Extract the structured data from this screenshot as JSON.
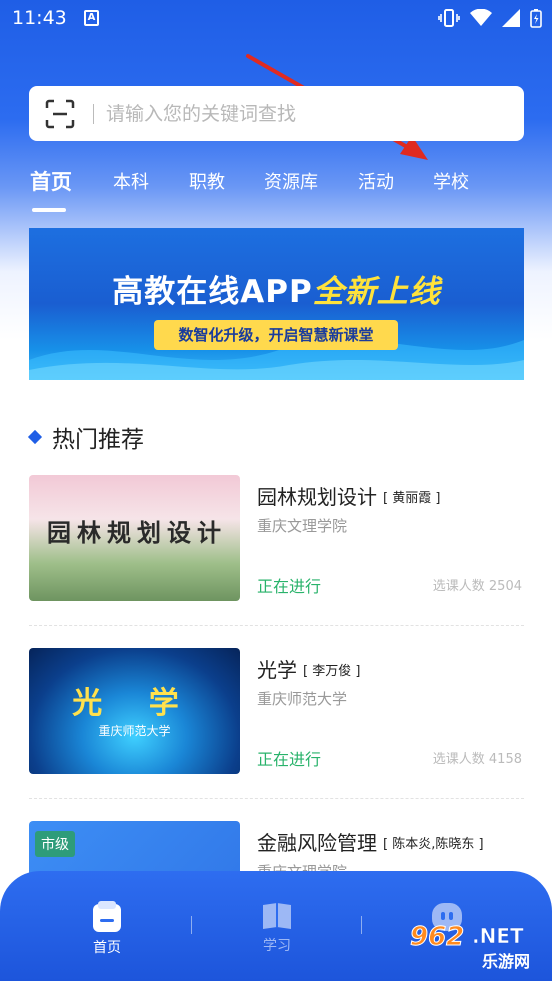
{
  "status_bar": {
    "time": "11:43",
    "app_icon": "A"
  },
  "search": {
    "placeholder": "请输入您的关键词查找",
    "value": ""
  },
  "tabs": [
    {
      "label": "首页",
      "active": true
    },
    {
      "label": "本科",
      "active": false
    },
    {
      "label": "职教",
      "active": false
    },
    {
      "label": "资源库",
      "active": false
    },
    {
      "label": "活动",
      "active": false
    },
    {
      "label": "学校",
      "active": false
    }
  ],
  "banner": {
    "title_main": "高教在线APP",
    "title_highlight": "全新上线",
    "subtitle": "数智化升级，开启智慧新课堂"
  },
  "section": {
    "title": "热门推荐"
  },
  "courses": [
    {
      "title": "园林规划设计",
      "teacher": "[ 黄丽霞 ]",
      "school": "重庆文理学院",
      "status": "正在进行",
      "count": "选课人数 2504",
      "thumb_text": "园林规划设计"
    },
    {
      "title": "光学",
      "teacher": "[ 李万俊 ]",
      "school": "重庆师范大学",
      "status": "正在进行",
      "count": "选课人数 4158",
      "thumb_text": "光 学",
      "thumb_sub": "重庆师范大学"
    },
    {
      "title": "金融风险管理",
      "teacher": "[ 陈本炎,陈晓东 ]",
      "school": "重庆文理学院",
      "badge": "市级"
    }
  ],
  "bottom_nav": [
    {
      "label": "首页",
      "icon": "home-icon",
      "active": true
    },
    {
      "label": "学习",
      "icon": "book-icon",
      "active": false
    },
    {
      "label": "",
      "icon": "robot-face-icon",
      "active": false
    }
  ],
  "watermark": {
    "text": "962.NET",
    "sub": "乐游网"
  },
  "colors": {
    "primary": "#1f5ee6",
    "status_green": "#29b36b",
    "banner_yellow": "#ffd94d"
  }
}
